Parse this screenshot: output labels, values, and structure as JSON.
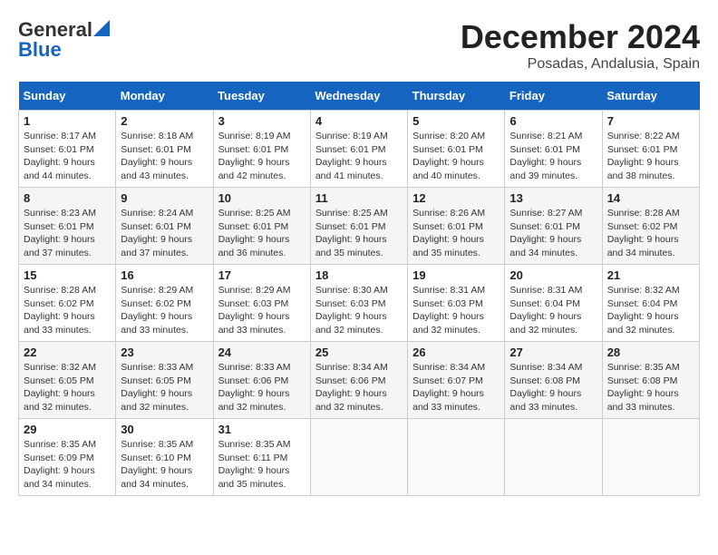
{
  "header": {
    "logo_general": "General",
    "logo_blue": "Blue",
    "month_title": "December 2024",
    "location": "Posadas, Andalusia, Spain"
  },
  "weekdays": [
    "Sunday",
    "Monday",
    "Tuesday",
    "Wednesday",
    "Thursday",
    "Friday",
    "Saturday"
  ],
  "weeks": [
    [
      {
        "day": "1",
        "sunrise": "8:17 AM",
        "sunset": "6:01 PM",
        "daylight": "9 hours and 44 minutes."
      },
      {
        "day": "2",
        "sunrise": "8:18 AM",
        "sunset": "6:01 PM",
        "daylight": "9 hours and 43 minutes."
      },
      {
        "day": "3",
        "sunrise": "8:19 AM",
        "sunset": "6:01 PM",
        "daylight": "9 hours and 42 minutes."
      },
      {
        "day": "4",
        "sunrise": "8:19 AM",
        "sunset": "6:01 PM",
        "daylight": "9 hours and 41 minutes."
      },
      {
        "day": "5",
        "sunrise": "8:20 AM",
        "sunset": "6:01 PM",
        "daylight": "9 hours and 40 minutes."
      },
      {
        "day": "6",
        "sunrise": "8:21 AM",
        "sunset": "6:01 PM",
        "daylight": "9 hours and 39 minutes."
      },
      {
        "day": "7",
        "sunrise": "8:22 AM",
        "sunset": "6:01 PM",
        "daylight": "9 hours and 38 minutes."
      }
    ],
    [
      {
        "day": "8",
        "sunrise": "8:23 AM",
        "sunset": "6:01 PM",
        "daylight": "9 hours and 37 minutes."
      },
      {
        "day": "9",
        "sunrise": "8:24 AM",
        "sunset": "6:01 PM",
        "daylight": "9 hours and 37 minutes."
      },
      {
        "day": "10",
        "sunrise": "8:25 AM",
        "sunset": "6:01 PM",
        "daylight": "9 hours and 36 minutes."
      },
      {
        "day": "11",
        "sunrise": "8:25 AM",
        "sunset": "6:01 PM",
        "daylight": "9 hours and 35 minutes."
      },
      {
        "day": "12",
        "sunrise": "8:26 AM",
        "sunset": "6:01 PM",
        "daylight": "9 hours and 35 minutes."
      },
      {
        "day": "13",
        "sunrise": "8:27 AM",
        "sunset": "6:01 PM",
        "daylight": "9 hours and 34 minutes."
      },
      {
        "day": "14",
        "sunrise": "8:28 AM",
        "sunset": "6:02 PM",
        "daylight": "9 hours and 34 minutes."
      }
    ],
    [
      {
        "day": "15",
        "sunrise": "8:28 AM",
        "sunset": "6:02 PM",
        "daylight": "9 hours and 33 minutes."
      },
      {
        "day": "16",
        "sunrise": "8:29 AM",
        "sunset": "6:02 PM",
        "daylight": "9 hours and 33 minutes."
      },
      {
        "day": "17",
        "sunrise": "8:29 AM",
        "sunset": "6:03 PM",
        "daylight": "9 hours and 33 minutes."
      },
      {
        "day": "18",
        "sunrise": "8:30 AM",
        "sunset": "6:03 PM",
        "daylight": "9 hours and 32 minutes."
      },
      {
        "day": "19",
        "sunrise": "8:31 AM",
        "sunset": "6:03 PM",
        "daylight": "9 hours and 32 minutes."
      },
      {
        "day": "20",
        "sunrise": "8:31 AM",
        "sunset": "6:04 PM",
        "daylight": "9 hours and 32 minutes."
      },
      {
        "day": "21",
        "sunrise": "8:32 AM",
        "sunset": "6:04 PM",
        "daylight": "9 hours and 32 minutes."
      }
    ],
    [
      {
        "day": "22",
        "sunrise": "8:32 AM",
        "sunset": "6:05 PM",
        "daylight": "9 hours and 32 minutes."
      },
      {
        "day": "23",
        "sunrise": "8:33 AM",
        "sunset": "6:05 PM",
        "daylight": "9 hours and 32 minutes."
      },
      {
        "day": "24",
        "sunrise": "8:33 AM",
        "sunset": "6:06 PM",
        "daylight": "9 hours and 32 minutes."
      },
      {
        "day": "25",
        "sunrise": "8:34 AM",
        "sunset": "6:06 PM",
        "daylight": "9 hours and 32 minutes."
      },
      {
        "day": "26",
        "sunrise": "8:34 AM",
        "sunset": "6:07 PM",
        "daylight": "9 hours and 33 minutes."
      },
      {
        "day": "27",
        "sunrise": "8:34 AM",
        "sunset": "6:08 PM",
        "daylight": "9 hours and 33 minutes."
      },
      {
        "day": "28",
        "sunrise": "8:35 AM",
        "sunset": "6:08 PM",
        "daylight": "9 hours and 33 minutes."
      }
    ],
    [
      {
        "day": "29",
        "sunrise": "8:35 AM",
        "sunset": "6:09 PM",
        "daylight": "9 hours and 34 minutes."
      },
      {
        "day": "30",
        "sunrise": "8:35 AM",
        "sunset": "6:10 PM",
        "daylight": "9 hours and 34 minutes."
      },
      {
        "day": "31",
        "sunrise": "8:35 AM",
        "sunset": "6:11 PM",
        "daylight": "9 hours and 35 minutes."
      },
      null,
      null,
      null,
      null
    ]
  ]
}
